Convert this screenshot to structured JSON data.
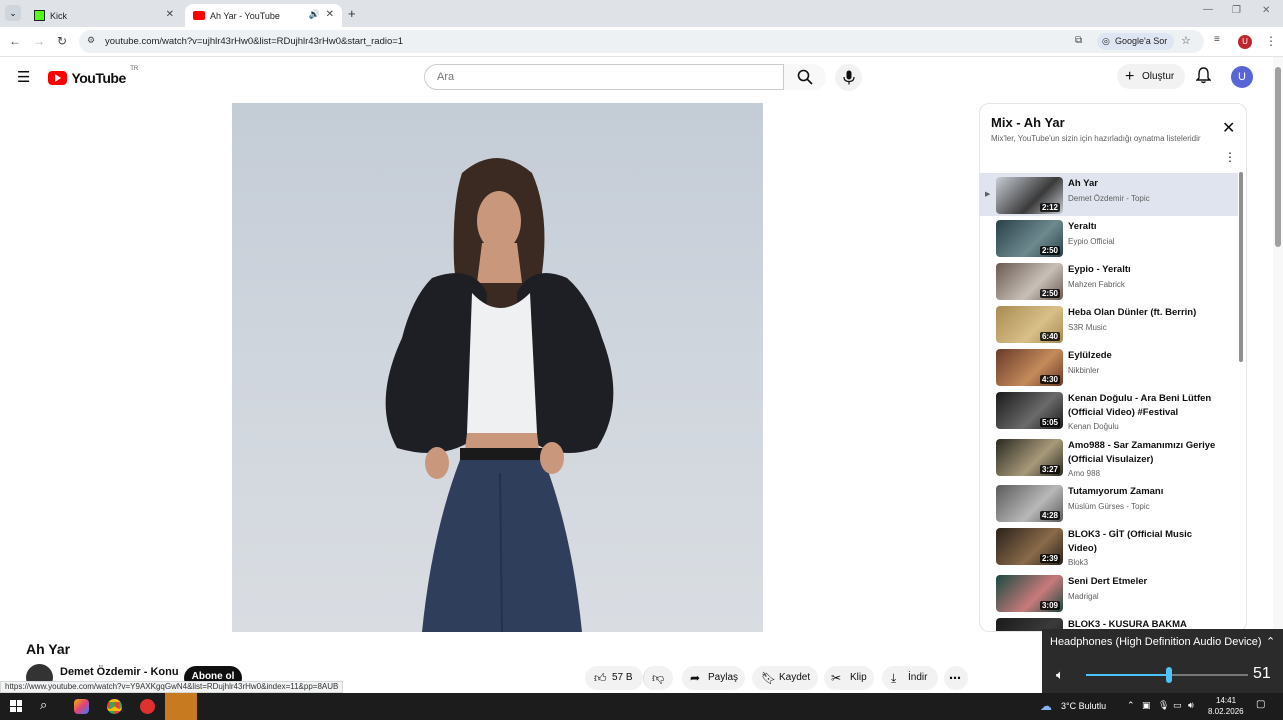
{
  "browser": {
    "tabs": [
      {
        "label": "Kick",
        "icon": "kick-logo-icon"
      },
      {
        "label": "Ah Yar - YouTube",
        "icon": "youtube-favicon-icon",
        "audio": "speaker-icon"
      }
    ],
    "url": "youtube.com/watch?v=ujhlr43rHw0&list=RDujhlr43rHw0&start_radio=1",
    "google_ask": "Google'a Sor",
    "profile_letter": "U"
  },
  "youtube": {
    "logo_text": "YouTube",
    "region": "TR",
    "search_placeholder": "Ara",
    "create_label": "Oluştur",
    "avatar_letter": "U"
  },
  "video": {
    "title": "Ah Yar",
    "channel": "Demet Özdemir - Konu",
    "subscribe": "Abone ol",
    "likes": "57 B",
    "share": "Paylaş",
    "save": "Kaydet",
    "clip": "Klip",
    "download": "İndir"
  },
  "status_url": "https://www.youtube.com/watch?v=Y9AXKgqGwN4&list=RDujhlr43rHw0&index=11&pp=8AUB",
  "playlist": {
    "title": "Mix - Ah Yar",
    "subtitle": "Mix'ler, YouTube'un sizin için hazırladığı oynatma listeleridir",
    "items": [
      {
        "title": "Ah Yar",
        "channel": "Demet Özdemir - Topic",
        "duration": "2:12",
        "thumb": "#c9ced6",
        "thumb2": "#3a3a3a"
      },
      {
        "title": "Yeraltı",
        "channel": "Eypio Official",
        "duration": "2:50",
        "thumb": "#2a4048",
        "thumb2": "#6d8a8f"
      },
      {
        "title": "Eypio - Yeraltı",
        "channel": "Mahzen Fabrick",
        "duration": "2:50",
        "thumb": "#6a5a52",
        "thumb2": "#c8c0b8"
      },
      {
        "title": "Heba Olan Dünler (ft. Berrin)",
        "channel": "S3R Music",
        "duration": "6:40",
        "thumb": "#a88a52",
        "thumb2": "#d8c088"
      },
      {
        "title": "Eylülzede",
        "channel": "Nikbinler",
        "duration": "4:30",
        "thumb": "#6a3a2a",
        "thumb2": "#c48a5a"
      },
      {
        "title": "Kenan Doğulu - Ara Beni Lütfen (Official Video) #Festival",
        "channel": "Kenan Doğulu",
        "duration": "5:05",
        "thumb": "#1a1a1a",
        "thumb2": "#6a6a6a"
      },
      {
        "title": "Amo988 - Sar Zamanımızı Geriye (Official Visulaizer)",
        "channel": "Amo 988",
        "duration": "3:27",
        "thumb": "#2a2a22",
        "thumb2": "#a89a7a"
      },
      {
        "title": "Tutamıyorum Zamanı",
        "channel": "Müslüm Gürses - Topic",
        "duration": "4:28",
        "thumb": "#5a5a5a",
        "thumb2": "#b8b8b8"
      },
      {
        "title": "BLOK3 - GİT (Official Music Video)",
        "channel": "Blok3",
        "duration": "2:39",
        "thumb": "#2a221a",
        "thumb2": "#8a6a4a"
      },
      {
        "title": "Seni Dert Etmeler",
        "channel": "Madrigal",
        "duration": "3:09",
        "thumb": "#1a4a42",
        "thumb2": "#c87a7a"
      },
      {
        "title": "BLOK3 - KUSURA BAKMA",
        "channel": "",
        "duration": "",
        "thumb": "#1a1a1a",
        "thumb2": "#3a3a3a"
      }
    ]
  },
  "volume": {
    "device": "Headphones (High Definition Audio Device)",
    "level": 51,
    "level_fraction": 0.51
  },
  "taskbar": {
    "weather": "3°C  Bulutlu",
    "time": "14:41",
    "date": "8.02.2026"
  }
}
